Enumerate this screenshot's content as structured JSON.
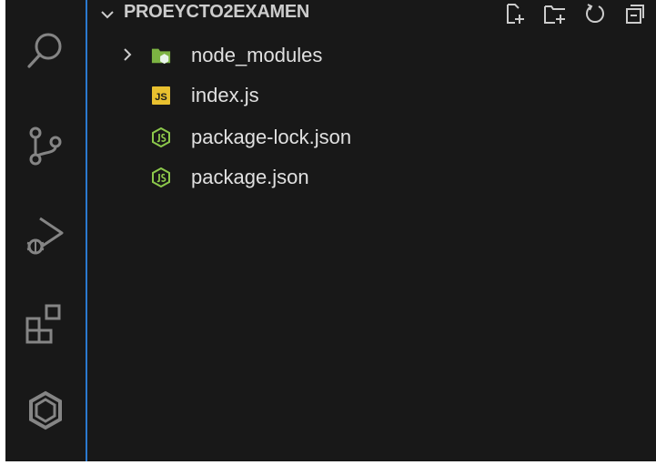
{
  "explorer": {
    "title": "PROEYCTO2EXAMEN",
    "actions": [
      {
        "icon": "new-file-icon"
      },
      {
        "icon": "new-folder-icon"
      },
      {
        "icon": "refresh-icon"
      },
      {
        "icon": "collapse-all-icon"
      }
    ]
  },
  "activity_bar": {
    "items": [
      {
        "icon": "search-icon"
      },
      {
        "icon": "source-control-icon"
      },
      {
        "icon": "run-debug-icon"
      },
      {
        "icon": "extensions-icon"
      },
      {
        "icon": "remote-icon"
      }
    ]
  },
  "tree": {
    "items": [
      {
        "label": "node_modules",
        "type": "folder",
        "icon": "node-modules-folder-icon",
        "collapsed": true
      },
      {
        "label": "index.js",
        "type": "file",
        "icon": "javascript-file-icon",
        "badge": "JS"
      },
      {
        "label": "package-lock.json",
        "type": "file",
        "icon": "nodejs-file-icon"
      },
      {
        "label": "package.json",
        "type": "file",
        "icon": "nodejs-file-icon"
      }
    ]
  },
  "colors": {
    "background": "#181818",
    "text": "#e0e0e0",
    "header_text": "#cccccc",
    "focus_border": "#2b79d0",
    "folder_green": "#8bc34a",
    "node_green": "#8cc84b",
    "js_yellow": "#e8c02f",
    "icon_gray": "#858585"
  }
}
